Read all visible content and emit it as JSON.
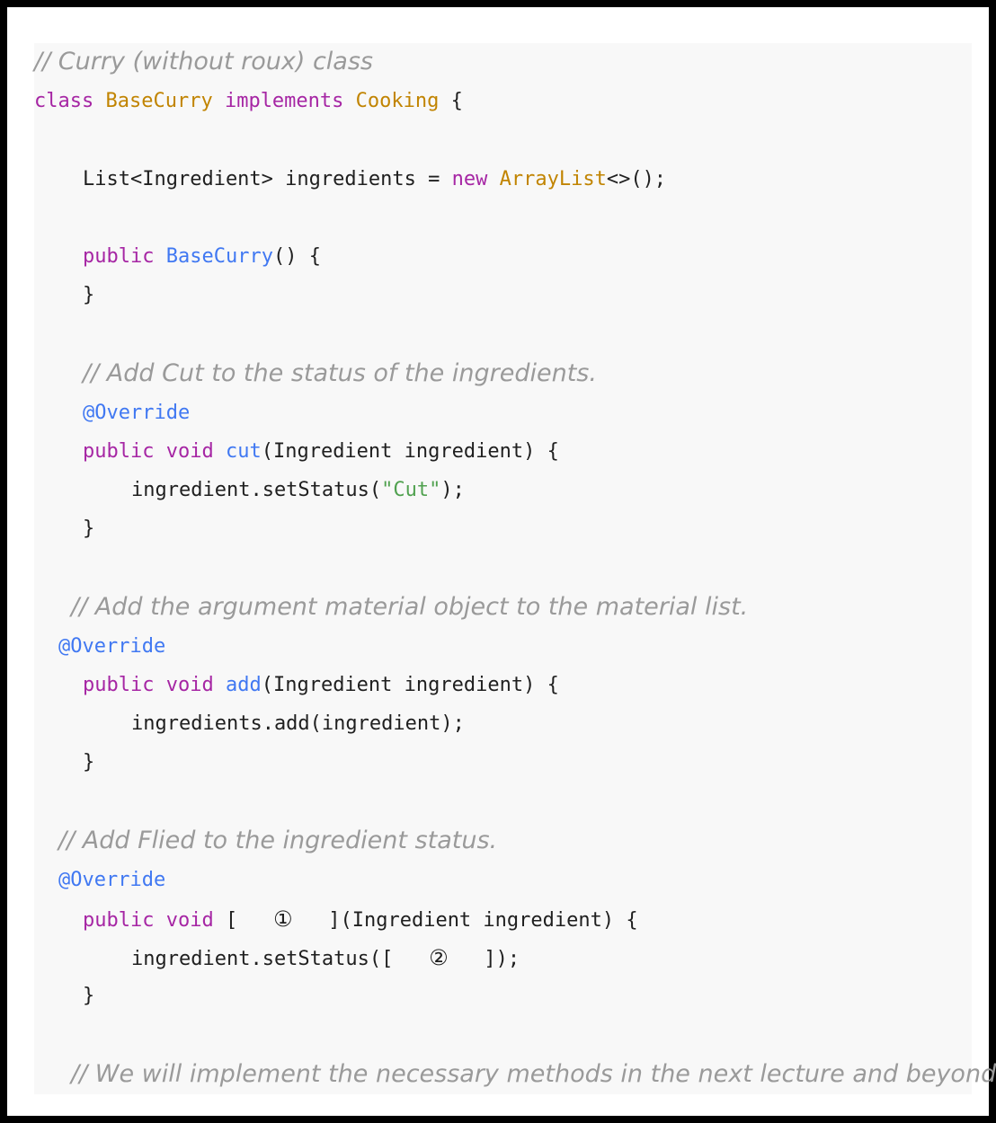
{
  "code": {
    "comment_class": "// Curry (without roux) class",
    "class_kw": "class",
    "class_name": "BaseCurry",
    "implements_kw": "implements",
    "interface_name": "Cooking",
    "open_brace": " {",
    "field_decl": "List<Ingredient> ingredients = ",
    "new_kw": "new",
    "arraylist_type": "ArrayList",
    "field_end": "<>();",
    "ctor_public": "public",
    "ctor_name": "BaseCurry",
    "ctor_tail": "() {",
    "close_brace": "}",
    "comment_cut": "// Add Cut to the status of the ingredients.",
    "override": "@Override",
    "public_kw": "public",
    "void_kw": "void",
    "method_cut": "cut",
    "params": "(Ingredient ingredient) {",
    "cut_body_pre": "ingredient.setStatus(",
    "cut_string": "\"Cut\"",
    "cut_body_post": ");",
    "comment_add": "// Add the argument material object to the material list.",
    "method_add": "add",
    "add_body": "ingredients.add(ingredient);",
    "comment_fried": "// Add Flied to the ingredient status.",
    "blank_open": "[",
    "blank_1": "①",
    "blank_close": "]",
    "blank_2": "②",
    "fried_body_pre": "ingredient.setStatus(",
    "fried_body_post": ");",
    "comment_next": "// We will implement the necessary methods in the next lecture and beyond."
  }
}
